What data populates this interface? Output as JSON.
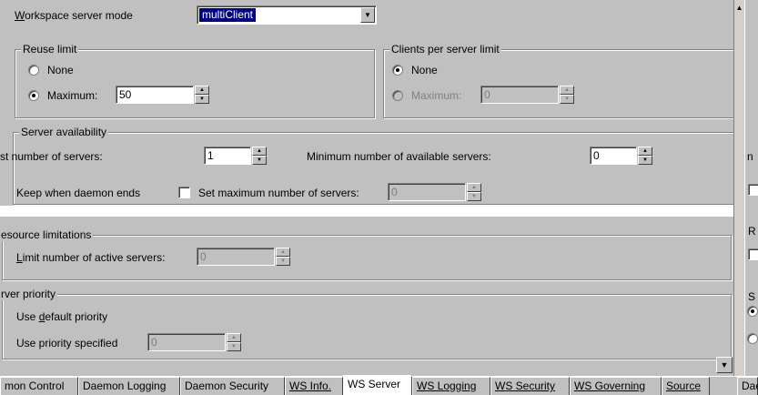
{
  "workspace": {
    "mode_label": "Workspace server mode",
    "mode_value": "multiClient"
  },
  "reuse_limit": {
    "title": "Reuse limit",
    "none_label": "None",
    "maximum_label": "Maximum:",
    "maximum_value": "50",
    "selected": "maximum"
  },
  "clients_limit": {
    "title": "Clients per server limit",
    "none_label": "None",
    "maximum_label": "Maximum:",
    "maximum_value": "0",
    "selected": "none"
  },
  "server_availability": {
    "title": "Server availability",
    "initial_label": "st number of servers:",
    "initial_value": "1",
    "min_available_label": "Minimum number of available servers:",
    "min_available_value": "0",
    "keep_label": "Keep when daemon ends",
    "set_max_label": "Set maximum number of servers:",
    "set_max_value": "0"
  },
  "resource_limitations": {
    "title": "esource limitations",
    "limit_label": "Limit number of active servers:",
    "limit_value": "0"
  },
  "server_priority": {
    "title": "rver priority",
    "default_label": "Use default priority",
    "specified_label": "Use priority specified",
    "specified_value": "0"
  },
  "right_panel": {
    "letter_1": "n",
    "letter_2": "R",
    "letter_3": "S"
  },
  "tabs": [
    {
      "label": "mon Control"
    },
    {
      "label": "Daemon Logging"
    },
    {
      "label": "Daemon Security"
    },
    {
      "label": "WS Info."
    },
    {
      "label": "WS Server"
    },
    {
      "label": "WS Logging"
    },
    {
      "label": "WS Security"
    },
    {
      "label": "WS Governing"
    },
    {
      "label": "Source"
    },
    {
      "label": "Dae"
    }
  ],
  "active_tab": "WS Server",
  "colors": {
    "dialog_bg": "#c0c0c0",
    "selection": "#000080"
  }
}
